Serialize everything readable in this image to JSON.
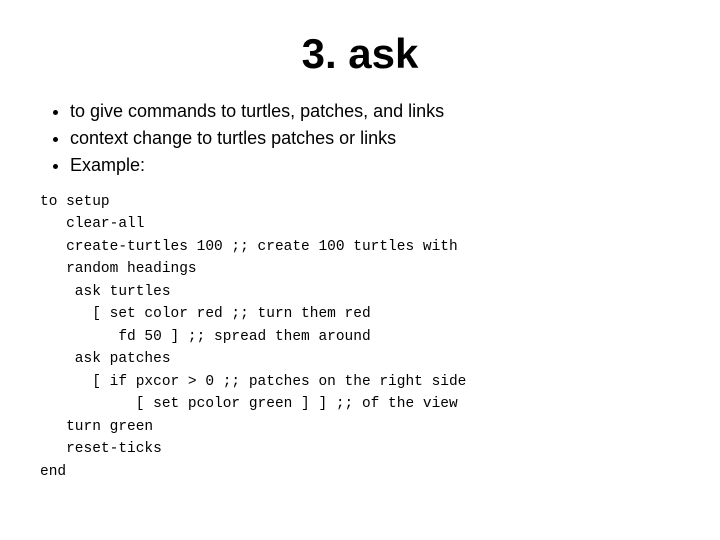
{
  "title": "3. ask",
  "bullets": [
    "to give commands to turtles, patches, and links",
    "context change to turtles patches or links",
    "Example:"
  ],
  "code": "to setup\n   clear-all\n   create-turtles 100 ;; create 100 turtles with\n   random headings\n    ask turtles\n      [ set color red ;; turn them red\n         fd 50 ] ;; spread them around\n    ask patches\n      [ if pxcor > 0 ;; patches on the right side\n           [ set pcolor green ] ] ;; of the view\n   turn green\n   reset-ticks\nend"
}
